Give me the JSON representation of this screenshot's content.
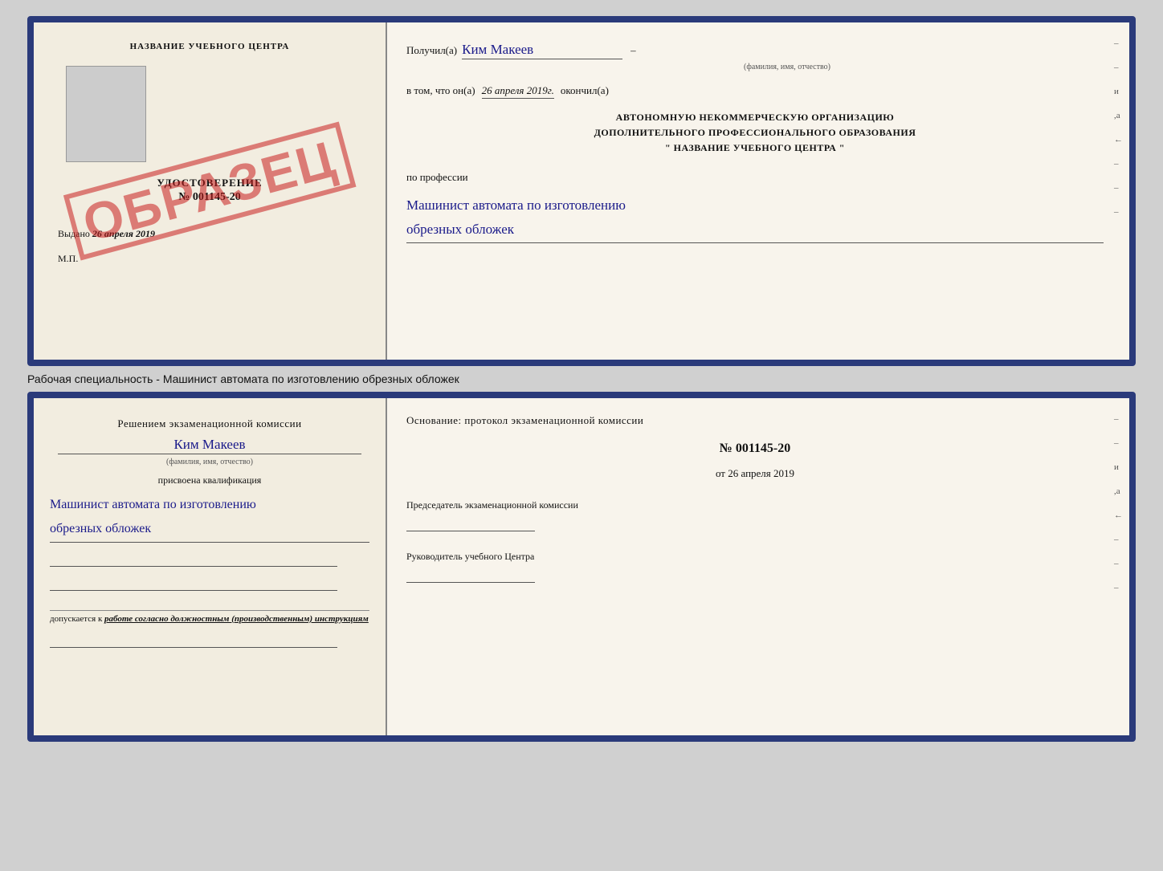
{
  "top_doc": {
    "left": {
      "center_title": "НАЗВАНИЕ УЧЕБНОГО ЦЕНТРА",
      "udostoverenie_title": "УДОСТОВЕРЕНИЕ",
      "cert_number": "№ 001145-20",
      "vydano_label": "Выдано",
      "vydano_date": "26 апреля 2019",
      "mp_label": "М.П.",
      "stamp_text": "ОБРАЗЕЦ"
    },
    "right": {
      "poluchil_label": "Получил(а)",
      "poluchil_name": "Ким Макеев",
      "poluchil_dash": "–",
      "fio_hint": "(фамилия, имя, отчество)",
      "vtom_label": "в том, что он(а)",
      "vtom_date": "26 апреля 2019г.",
      "okonchil_label": "окончил(а)",
      "org_line1": "АВТОНОМНУЮ НЕКОММЕРЧЕСКУЮ ОРГАНИЗАЦИЮ",
      "org_line2": "ДОПОЛНИТЕЛЬНОГО ПРОФЕССИОНАЛЬНОГО ОБРАЗОВАНИЯ",
      "org_line3": "\"  НАЗВАНИЕ УЧЕБНОГО ЦЕНТРА  \"",
      "po_professii_label": "по профессии",
      "profession_line1": "Машинист автомата по изготовлению",
      "profession_line2": "обрезных обложек"
    }
  },
  "caption": {
    "text": "Рабочая специальность - Машинист автомата по изготовлению обрезных обложек"
  },
  "bottom_doc": {
    "left": {
      "resheniem_text": "Решением экзаменационной комиссии",
      "name": "Ким Макеев",
      "fio_hint": "(фамилия, имя, отчество)",
      "prisvoena_text": "присвоена квалификация",
      "kvalif_line1": "Машинист автомата по изготовлению",
      "kvalif_line2": "обрезных обложек",
      "dopuskaetsya_prefix": "допускается к",
      "dopuskaetsya_italic": "работе согласно должностным (производственным) инструкциям"
    },
    "right": {
      "osnovanie_label": "Основание: протокол экзаменационной комиссии",
      "protocol_number": "№ 001145-20",
      "ot_label": "от",
      "ot_date": "26 апреля 2019",
      "predsedatel_label": "Председатель экзаменационной комиссии",
      "rukovoditel_label": "Руководитель учебного Центра"
    }
  },
  "right_marks": [
    "-",
    "-",
    "и",
    "а",
    "←",
    "-",
    "-",
    "-"
  ]
}
